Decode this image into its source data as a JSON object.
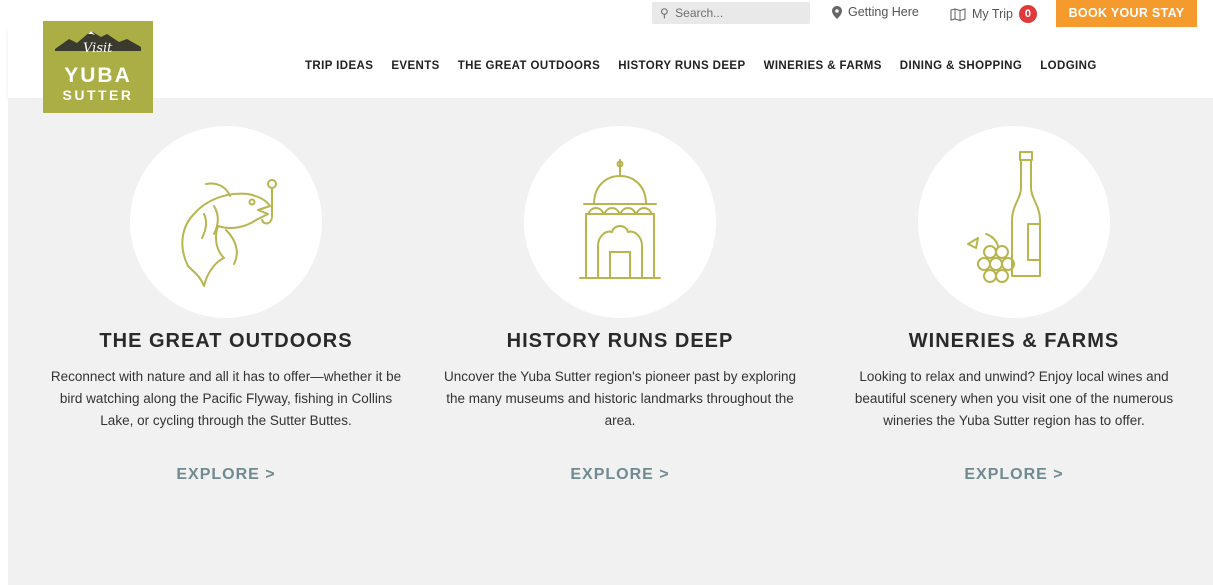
{
  "utility": {
    "search_placeholder": "Search...",
    "getting_here": "Getting Here",
    "my_trip": "My Trip",
    "trip_count": "0",
    "book_label": "BOOK YOUR STAY"
  },
  "logo": {
    "visit": "Visit",
    "line1": "YUBA",
    "line2": "SUTTER",
    "brand_color": "#aaae45"
  },
  "nav": {
    "items": [
      {
        "label": "TRIP IDEAS"
      },
      {
        "label": "EVENTS"
      },
      {
        "label": "THE GREAT OUTDOORS"
      },
      {
        "label": "HISTORY RUNS DEEP"
      },
      {
        "label": "WINERIES & FARMS"
      },
      {
        "label": "DINING & SHOPPING"
      },
      {
        "label": "LODGING"
      }
    ]
  },
  "cards": [
    {
      "icon": "fish-icon",
      "title": "THE GREAT OUTDOORS",
      "description": "Reconnect with nature and all it has to offer—whether it be bird watching along the Pacific Flyway, fishing in Collins Lake, or cycling through the Sutter Buttes.",
      "cta": "EXPLORE >"
    },
    {
      "icon": "temple-icon",
      "title": "HISTORY RUNS DEEP",
      "description": "Uncover the Yuba Sutter region's pioneer past by exploring the many museums and historic landmarks throughout the area.",
      "cta": "EXPLORE >"
    },
    {
      "icon": "wine-bottle-icon",
      "title": "WINERIES & FARMS",
      "description": "Looking to relax and unwind? Enjoy local wines and beautiful scenery when you visit one of the numerous wineries the Yuba Sutter region has to offer.",
      "cta": "EXPLORE >"
    }
  ],
  "colors": {
    "accent_orange": "#f59a2c",
    "icon_green": "#b7b54e",
    "cta_gray": "#6f8a90",
    "badge_red": "#e03a3a"
  }
}
